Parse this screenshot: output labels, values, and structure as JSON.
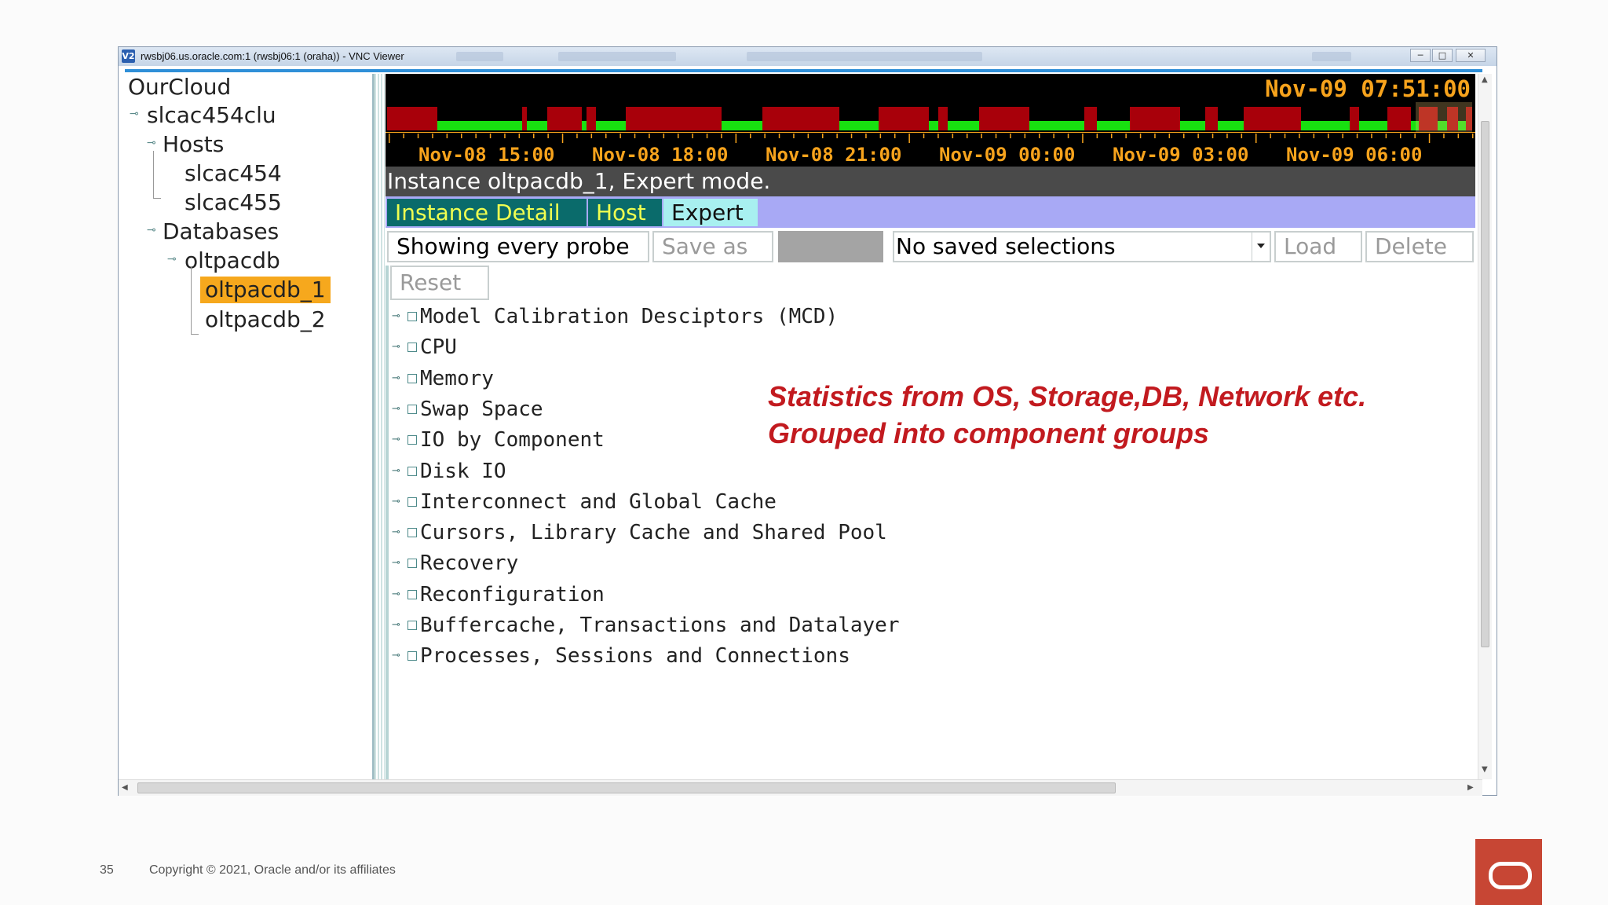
{
  "window": {
    "title": "rwsbj06.us.oracle.com:1 (rwsbj06:1 (oraha)) - VNC Viewer",
    "icon_text": "V2",
    "controls": [
      "─",
      "□",
      "✕"
    ]
  },
  "tree": {
    "root": "OurCloud",
    "cluster": "slcac454clu",
    "hosts_label": "Hosts",
    "hosts": [
      "slcac454",
      "slcac455"
    ],
    "databases_label": "Databases",
    "database": "oltpacdb",
    "instances": [
      "oltpacdb_1",
      "oltpacdb_2"
    ],
    "selected": "oltpacdb_1"
  },
  "timeline": {
    "current": "Nov-09 07:51:00",
    "labels": [
      "Nov-08 15:00",
      "Nov-08 18:00",
      "Nov-08 21:00",
      "Nov-09 00:00",
      "Nov-09 03:00",
      "Nov-09 06:00"
    ],
    "colors": {
      "alert": "#a8000a",
      "ok": "#18e010",
      "text": "#f7a31c"
    }
  },
  "status": "Instance oltpacdb_1, Expert mode.",
  "tabs": [
    "Instance Detail",
    "Host",
    "Expert"
  ],
  "active_tab": "Expert",
  "toolbar": {
    "probe_button": "Showing every probe",
    "save_as": "Save as",
    "selections_value": "No saved selections",
    "load": "Load",
    "delete": "Delete",
    "reset": "Reset"
  },
  "components": [
    "Model Calibration Desciptors (MCD)",
    "CPU",
    "Memory",
    "Swap Space",
    "IO by Component",
    "Disk IO",
    "Interconnect and Global Cache",
    "Cursors, Library Cache and Shared Pool",
    "Recovery",
    "Reconfiguration",
    "Buffercache, Transactions and Datalayer",
    "Processes, Sessions and Connections"
  ],
  "callout": {
    "line1": "Statistics from OS, Storage,DB, Network etc.",
    "line2": "Grouped into component groups"
  },
  "footer": {
    "page_number": "35",
    "copyright": "Copyright © 2021, Oracle and/or its affiliates"
  },
  "brand_color": "#c74634"
}
